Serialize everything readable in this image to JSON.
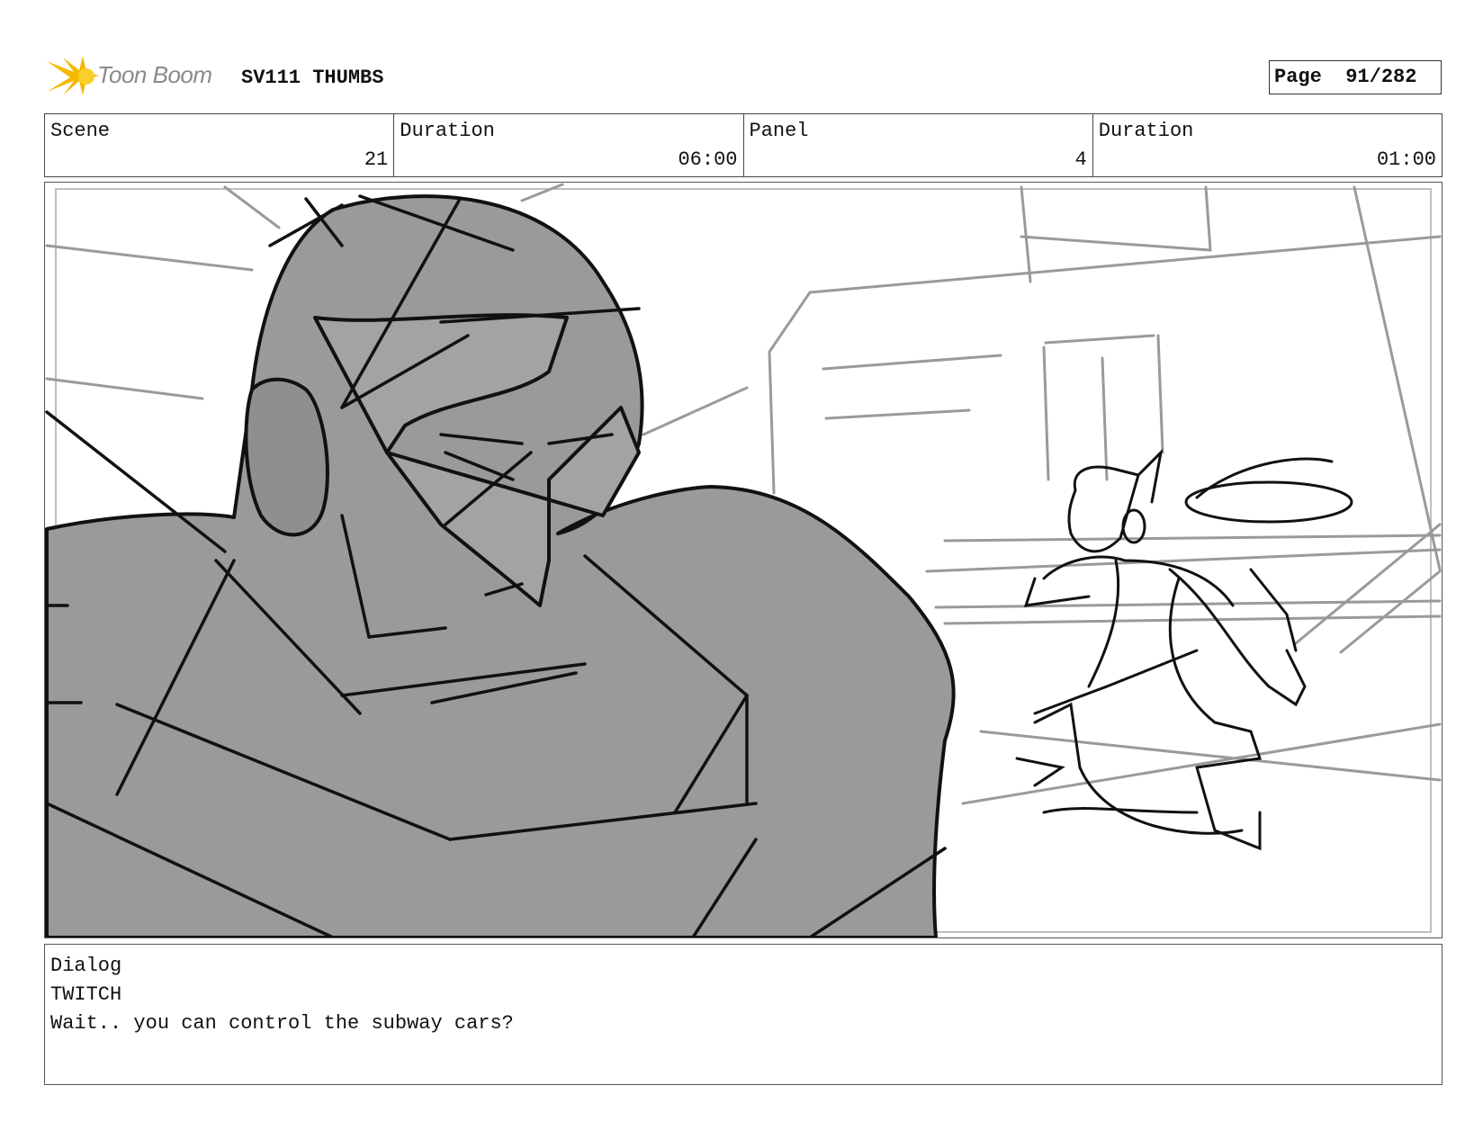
{
  "header": {
    "logo_text": "Toon Boom",
    "title": "SV111 THUMBS",
    "page_label": "Page",
    "page_value": "91/282"
  },
  "info": {
    "scene_label": "Scene",
    "scene_value": "21",
    "scene_duration_label": "Duration",
    "scene_duration_value": "06:00",
    "panel_label": "Panel",
    "panel_value": "4",
    "panel_duration_label": "Duration",
    "panel_duration_value": "01:00"
  },
  "dialog": {
    "label": "Dialog",
    "character": "TWITCH",
    "line": "Wait.. you can control the subway cars?"
  },
  "colors": {
    "logo_yellow": "#f5b800",
    "sketch_gray": "#999999",
    "line_black": "#111111"
  }
}
